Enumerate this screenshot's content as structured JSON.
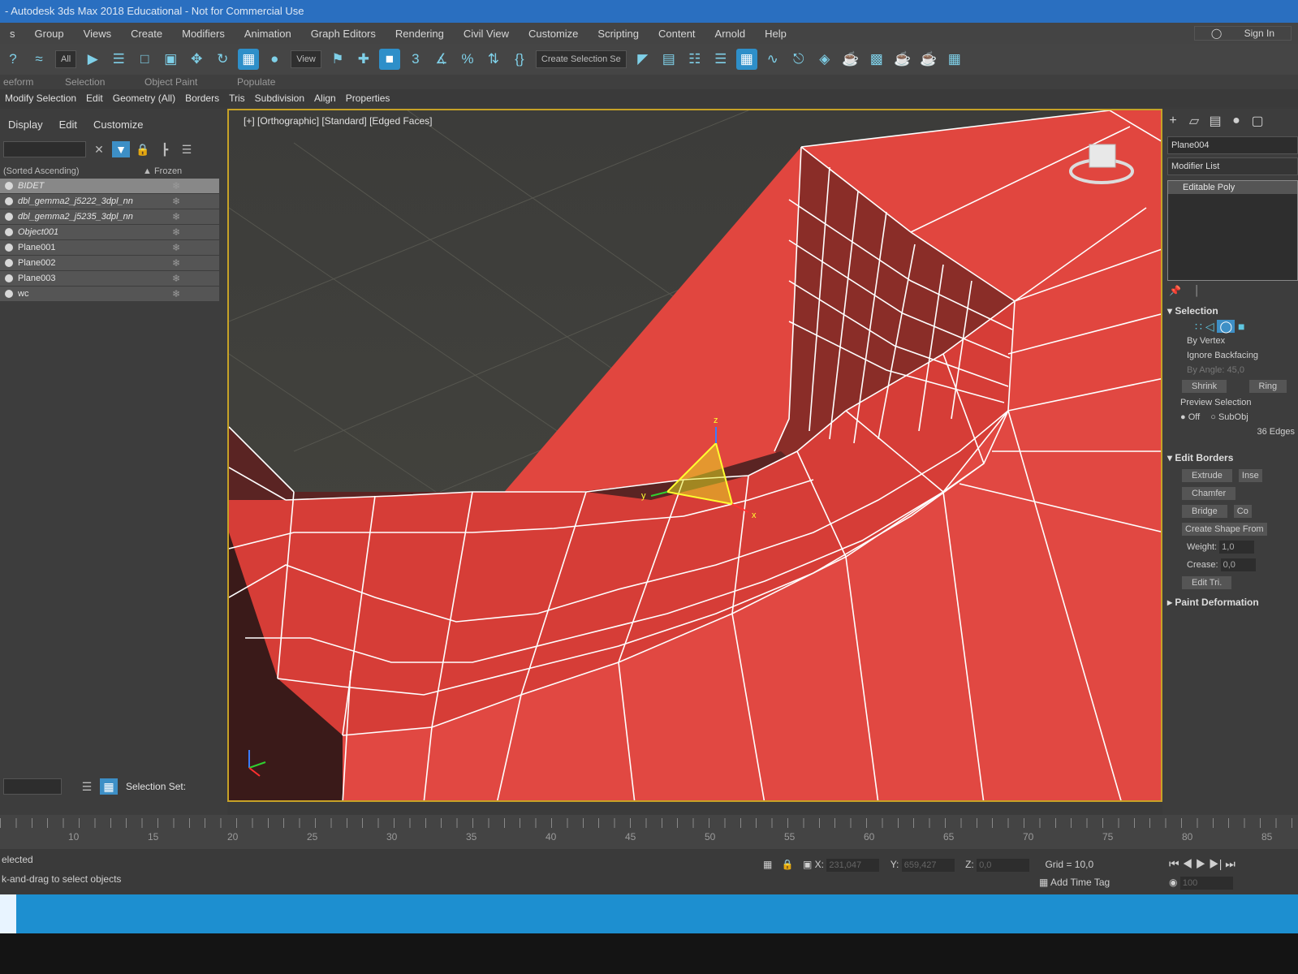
{
  "window": {
    "title": "- Autodesk 3ds Max 2018 Educational - Not for Commercial Use"
  },
  "menu": [
    "s",
    "Group",
    "Views",
    "Create",
    "Modifiers",
    "Animation",
    "Graph Editors",
    "Rendering",
    "Civil View",
    "Customize",
    "Scripting",
    "Content",
    "Arnold",
    "Help"
  ],
  "signin": "Sign In",
  "toolbar": {
    "filter": "All",
    "refcoord": "View",
    "selection_set": "Create Selection Se"
  },
  "ribbon_labels": [
    "eeform",
    "Selection",
    "Object Paint",
    "Populate"
  ],
  "ribbon": [
    "Modify Selection",
    "Edit",
    "Geometry (All)",
    "Borders",
    "Tris",
    "Subdivision",
    "Align",
    "Properties"
  ],
  "scene_explorer": {
    "tabs": [
      "Display",
      "Edit",
      "Customize"
    ],
    "sort_label": "(Sorted Ascending)",
    "frozen_label": "▲ Frozen",
    "objects": [
      {
        "name": "BIDET",
        "italic": true
      },
      {
        "name": "dbl_gemma2_j5222_3dpl_nn",
        "italic": true
      },
      {
        "name": "dbl_gemma2_j5235_3dpl_nn",
        "italic": true
      },
      {
        "name": "Object001",
        "italic": true
      },
      {
        "name": "Plane001",
        "italic": false
      },
      {
        "name": "Plane002",
        "italic": false
      },
      {
        "name": "Plane003",
        "italic": false
      },
      {
        "name": "wc",
        "italic": false
      }
    ],
    "selection_set_label": "Selection Set:"
  },
  "viewport": {
    "label": "[+] [Orthographic] [Standard] [Edged Faces]",
    "gizmo_axes": {
      "x": "x",
      "y": "y",
      "z": "z"
    }
  },
  "command_panel": {
    "object_name": "Plane004",
    "modifier_list": "Modifier List",
    "stack_item": "Editable Poly",
    "selection_title": "Selection",
    "by_vertex": "By Vertex",
    "ignore_backfacing": "Ignore Backfacing",
    "by_angle": "By Angle:",
    "by_angle_value": "45,0",
    "shrink": "Shrink",
    "ring": "Ring",
    "preview_selection": "Preview Selection",
    "off": "Off",
    "subobj": "SubObj",
    "edges_count": "36 Edges",
    "edit_borders_title": "Edit Borders",
    "extrude": "Extrude",
    "insert": "Inse",
    "chamfer": "Chamfer",
    "bridge": "Bridge",
    "connect": "Co",
    "create_shape": "Create Shape From",
    "weight_label": "Weight:",
    "weight_value": "1,0",
    "crease_label": "Crease:",
    "crease_value": "0,0",
    "edit_tri": "Edit Tri.",
    "paint_deformation": "Paint Deformation"
  },
  "timeline": {
    "ticks": [
      "10",
      "15",
      "20",
      "25",
      "30",
      "35",
      "40",
      "45",
      "50",
      "55",
      "60",
      "65",
      "70",
      "75",
      "80",
      "85"
    ]
  },
  "status": {
    "line1": "elected",
    "line2": "k-and-drag to select objects",
    "x_label": "X:",
    "x_value": "231,047",
    "y_label": "Y:",
    "y_value": "659,427",
    "z_label": "Z:",
    "z_value": "0,0",
    "grid": "Grid = 10,0",
    "add_time_tag": "Add Time Tag",
    "frame": "100"
  },
  "colors": {
    "mesh": "#e0453f",
    "mesh_dark": "#4a1f1e",
    "wire": "#ffffff",
    "gizmo": "#e8e820",
    "viewport_bg": "#3f3f3d",
    "selection_border": "#c6a227"
  }
}
